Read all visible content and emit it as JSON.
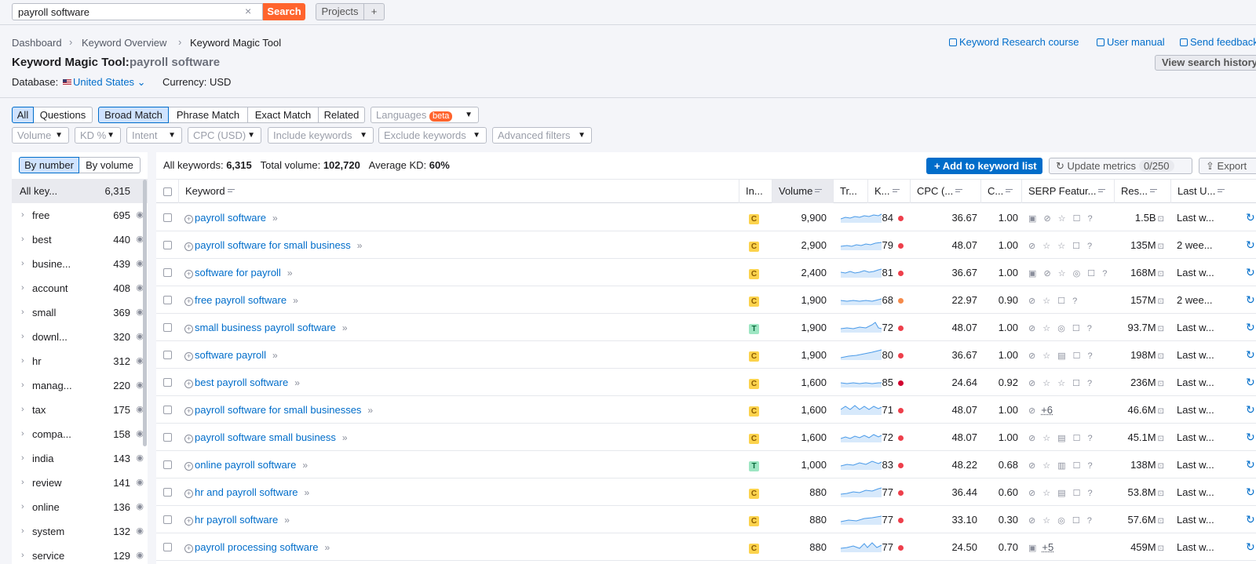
{
  "search": {
    "value": "payroll software",
    "button": "Search",
    "clear": "×"
  },
  "projects": {
    "label": "Projects",
    "add": "+"
  },
  "breadcrumb": [
    "Dashboard",
    "Keyword Overview",
    "Keyword Magic Tool"
  ],
  "breadcrumb_sep": "›",
  "top_links": {
    "course": "Keyword Research course",
    "manual": "User manual",
    "feedback": "Send feedback"
  },
  "history_btn": "View search history",
  "title": "Keyword Magic Tool:",
  "title_keyword": "payroll software",
  "database": {
    "label": "Database:",
    "value": "United States",
    "chevron": "⌄"
  },
  "currency": "Currency: USD",
  "type_tabs": [
    "All",
    "Questions"
  ],
  "match_tabs": [
    "Broad Match",
    "Phrase Match",
    "Exact Match",
    "Related"
  ],
  "languages": {
    "label": "Languages",
    "badge": "beta"
  },
  "filters": [
    "Volume",
    "KD %",
    "Intent",
    "CPC (USD)",
    "Include keywords",
    "Exclude keywords",
    "Advanced filters"
  ],
  "group_toggle": [
    "By number",
    "By volume"
  ],
  "groups": [
    {
      "label": "All key...",
      "count": "6,315"
    },
    {
      "label": "free",
      "count": "695"
    },
    {
      "label": "best",
      "count": "440"
    },
    {
      "label": "busine...",
      "count": "439"
    },
    {
      "label": "account",
      "count": "408"
    },
    {
      "label": "small",
      "count": "369"
    },
    {
      "label": "downl...",
      "count": "320"
    },
    {
      "label": "hr",
      "count": "312"
    },
    {
      "label": "manag...",
      "count": "220"
    },
    {
      "label": "tax",
      "count": "175"
    },
    {
      "label": "compa...",
      "count": "158"
    },
    {
      "label": "india",
      "count": "143"
    },
    {
      "label": "review",
      "count": "141"
    },
    {
      "label": "online",
      "count": "136"
    },
    {
      "label": "system",
      "count": "132"
    },
    {
      "label": "service",
      "count": "129"
    }
  ],
  "summary": {
    "all_label": "All keywords:",
    "all_value": "6,315",
    "volume_label": "Total volume:",
    "volume_value": "102,720",
    "kd_label": "Average KD:",
    "kd_value": "60%"
  },
  "actions": {
    "add": "+  Add to keyword list",
    "update": "Update metrics",
    "update_count": "0/250",
    "export": "Export"
  },
  "columns": [
    "Keyword",
    "In...",
    "Volume",
    "Tr...",
    "K...",
    "CPC (...",
    "C...",
    "SERP Featur...",
    "Res...",
    "Last U..."
  ],
  "rows": [
    {
      "keyword": "payroll software",
      "intent": "C",
      "volume": "9,900",
      "kd": "84",
      "kd_color": "#ee3f4b",
      "cpc": "36.67",
      "comp": "1.00",
      "serp": "▣ ⊘ ☆ ☐ ?",
      "serp_plus": "",
      "results": "1.5B",
      "updated": "Last w..."
    },
    {
      "keyword": "payroll software for small business",
      "intent": "C",
      "volume": "2,900",
      "kd": "79",
      "kd_color": "#ee3f4b",
      "cpc": "48.07",
      "comp": "1.00",
      "serp": "⊘ ☆ ☆ ☐ ?",
      "serp_plus": "",
      "results": "135M",
      "updated": "2 wee..."
    },
    {
      "keyword": "software for payroll",
      "intent": "C",
      "volume": "2,400",
      "kd": "81",
      "kd_color": "#ee3f4b",
      "cpc": "36.67",
      "comp": "1.00",
      "serp": "▣ ⊘ ☆ ◎ ☐ ?",
      "serp_plus": "",
      "results": "168M",
      "updated": "Last w..."
    },
    {
      "keyword": "free payroll software",
      "intent": "C",
      "volume": "1,900",
      "kd": "68",
      "kd_color": "#f58a4b",
      "cpc": "22.97",
      "comp": "0.90",
      "serp": "⊘ ☆ ☐ ?",
      "serp_plus": "",
      "results": "157M",
      "updated": "2 wee..."
    },
    {
      "keyword": "small business payroll software",
      "intent": "T",
      "volume": "1,900",
      "kd": "72",
      "kd_color": "#ee3f4b",
      "cpc": "48.07",
      "comp": "1.00",
      "serp": "⊘ ☆ ◎ ☐ ?",
      "serp_plus": "",
      "results": "93.7M",
      "updated": "Last w..."
    },
    {
      "keyword": "software payroll",
      "intent": "C",
      "volume": "1,900",
      "kd": "80",
      "kd_color": "#ee3f4b",
      "cpc": "36.67",
      "comp": "1.00",
      "serp": "⊘ ☆ ▤ ☐ ?",
      "serp_plus": "",
      "results": "198M",
      "updated": "Last w..."
    },
    {
      "keyword": "best payroll software",
      "intent": "C",
      "volume": "1,600",
      "kd": "85",
      "kd_color": "#d1002f",
      "cpc": "24.64",
      "comp": "0.92",
      "serp": "⊘ ☆ ☆ ☐ ?",
      "serp_plus": "",
      "results": "236M",
      "updated": "Last w..."
    },
    {
      "keyword": "payroll software for small businesses",
      "intent": "C",
      "volume": "1,600",
      "kd": "71",
      "kd_color": "#ee3f4b",
      "cpc": "48.07",
      "comp": "1.00",
      "serp": "⊘",
      "serp_plus": "+6",
      "results": "46.6M",
      "updated": "Last w..."
    },
    {
      "keyword": "payroll software small business",
      "intent": "C",
      "volume": "1,600",
      "kd": "72",
      "kd_color": "#ee3f4b",
      "cpc": "48.07",
      "comp": "1.00",
      "serp": "⊘ ☆ ▤ ☐ ?",
      "serp_plus": "",
      "results": "45.1M",
      "updated": "Last w..."
    },
    {
      "keyword": "online payroll software",
      "intent": "T",
      "volume": "1,000",
      "kd": "83",
      "kd_color": "#ee3f4b",
      "cpc": "48.22",
      "comp": "0.68",
      "serp": "⊘ ☆ ▥ ☐ ?",
      "serp_plus": "",
      "results": "138M",
      "updated": "Last w..."
    },
    {
      "keyword": "hr and payroll software",
      "intent": "C",
      "volume": "880",
      "kd": "77",
      "kd_color": "#ee3f4b",
      "cpc": "36.44",
      "comp": "0.60",
      "serp": "⊘ ☆ ▤ ☐ ?",
      "serp_plus": "",
      "results": "53.8M",
      "updated": "Last w..."
    },
    {
      "keyword": "hr payroll software",
      "intent": "C",
      "volume": "880",
      "kd": "77",
      "kd_color": "#ee3f4b",
      "cpc": "33.10",
      "comp": "0.30",
      "serp": "⊘ ☆ ◎ ☐ ?",
      "serp_plus": "",
      "results": "57.6M",
      "updated": "Last w..."
    },
    {
      "keyword": "payroll processing software",
      "intent": "C",
      "volume": "880",
      "kd": "77",
      "kd_color": "#ee3f4b",
      "cpc": "24.50",
      "comp": "0.70",
      "serp": "▣",
      "serp_plus": "+5",
      "results": "459M",
      "updated": "Last w..."
    }
  ]
}
